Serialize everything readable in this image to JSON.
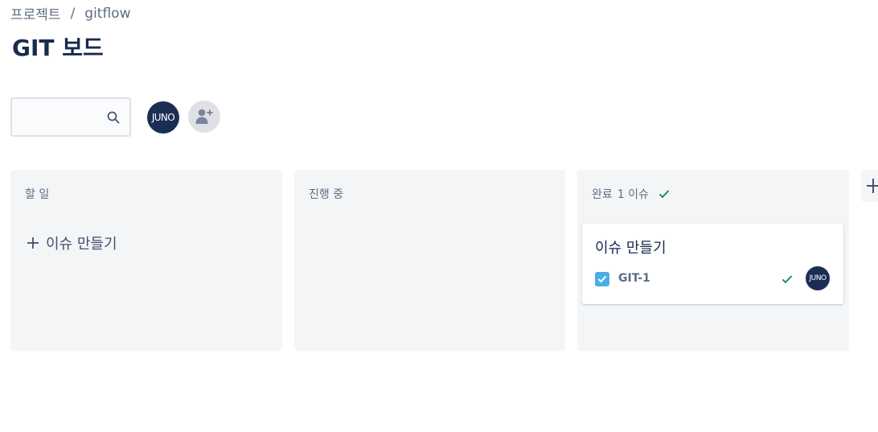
{
  "breadcrumb": {
    "project_label": "프로젝트",
    "separator": "/",
    "current": "gitflow"
  },
  "page": {
    "title": "GIT 보드"
  },
  "search": {
    "placeholder": "",
    "value": ""
  },
  "members": {
    "avatar_initials": "JUNO",
    "add_member_icon": "add-person-icon"
  },
  "colors": {
    "column_bg": "#f4f5f7",
    "avatar_bg": "#1a2e55",
    "checkbox_blue": "#4bade8",
    "check_green": "#00875a"
  },
  "columns": [
    {
      "title": "할 일",
      "create_label": "이슈 만들기"
    },
    {
      "title": "진행 중"
    },
    {
      "title": "완료",
      "count": "1 이슈",
      "done_icon": "check-icon",
      "cards": [
        {
          "title": "이슈 만들기",
          "key": "GIT-1",
          "assignee": "JUNO"
        }
      ]
    }
  ]
}
